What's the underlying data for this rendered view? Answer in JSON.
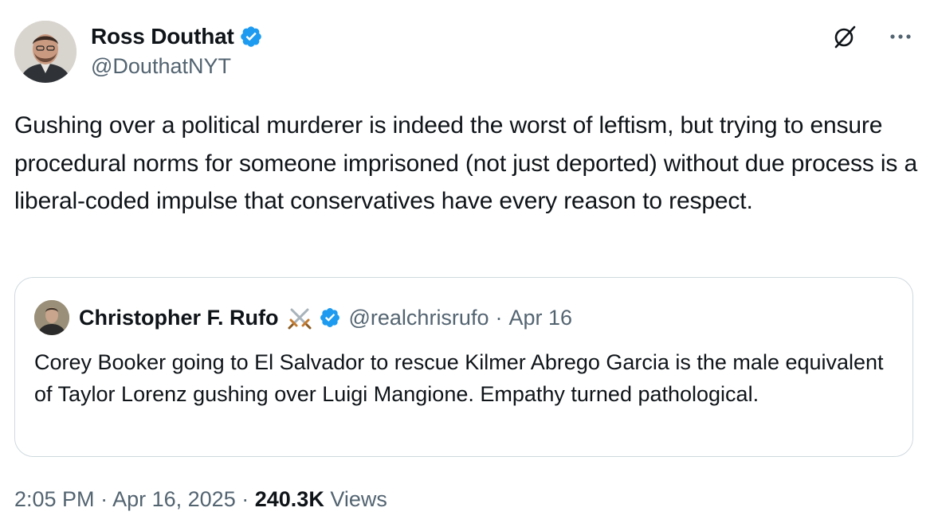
{
  "author": {
    "display_name": "Ross Douthat",
    "handle": "@DouthatNYT",
    "verified": true,
    "avatar_icon": "author-avatar"
  },
  "toolbar": {
    "grok_icon": "grok-icon",
    "more_icon": "more-icon"
  },
  "tweet": {
    "text": "Gushing over a political murderer is indeed the worst of leftism, but trying to ensure procedural norms for someone imprisoned (not just deported) without due process is a liberal-coded impulse that conservatives have every reason to respect."
  },
  "quoted": {
    "display_name": "Christopher F. Rufo",
    "name_emoji": "crossed-swords-icon",
    "verified": true,
    "handle": "@realchrisrufo",
    "separator": "·",
    "date": "Apr 16",
    "text": "Corey Booker going to El Salvador to rescue Kilmer Abrego Garcia is the male equivalent of Taylor Lorenz gushing over Luigi Mangione. Empathy turned pathological."
  },
  "meta": {
    "time": "2:05 PM",
    "sep1": "·",
    "date": "Apr 16, 2025",
    "sep2": "·",
    "views_count": "240.3K",
    "views_label": "Views"
  },
  "colors": {
    "verified_blue": "#1d9bf0",
    "secondary_text": "#536471",
    "primary_text": "#0f1419",
    "border": "#cfd9de"
  }
}
